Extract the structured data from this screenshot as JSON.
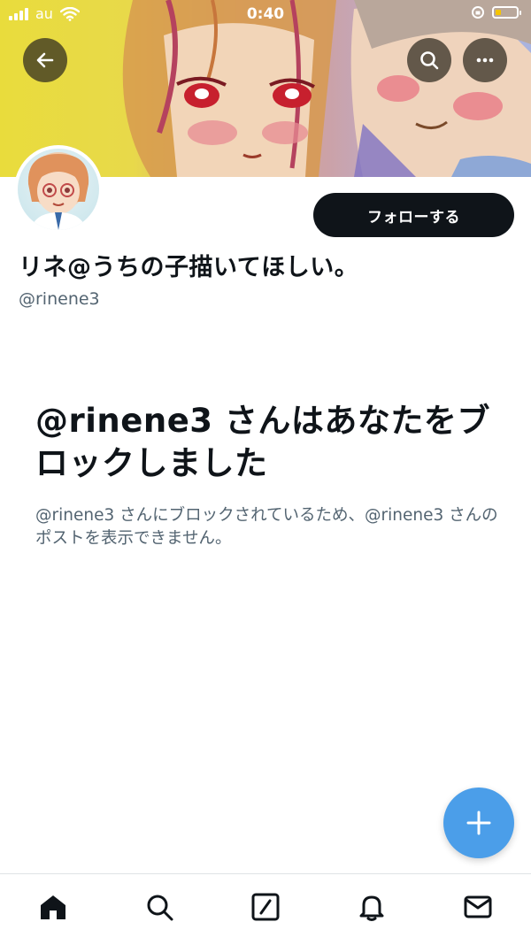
{
  "status_bar": {
    "carrier": "au",
    "time": "0:40"
  },
  "header": {
    "back_icon": "arrow-left-icon",
    "search_icon": "search-icon",
    "more_icon": "more-horizontal-icon"
  },
  "profile": {
    "display_name": "リネ@うちの子描いてほしい。",
    "handle": "@rinene3",
    "follow_label": "フォローする"
  },
  "blocked": {
    "title": "@rinene3 さんはあなたをブロックしました",
    "description": "@rinene3 さんにブロックされているため、@rinene3 さんのポストを表示できません。"
  },
  "fab": {
    "icon": "plus-icon"
  },
  "bottom_nav": {
    "items": [
      "home-icon",
      "search-icon",
      "compose-icon",
      "bell-icon",
      "mail-icon"
    ]
  },
  "colors": {
    "text_primary": "#0f1419",
    "text_secondary": "#536471",
    "fab_blue": "#4b9ee9",
    "follow_bg": "#0f1419"
  }
}
